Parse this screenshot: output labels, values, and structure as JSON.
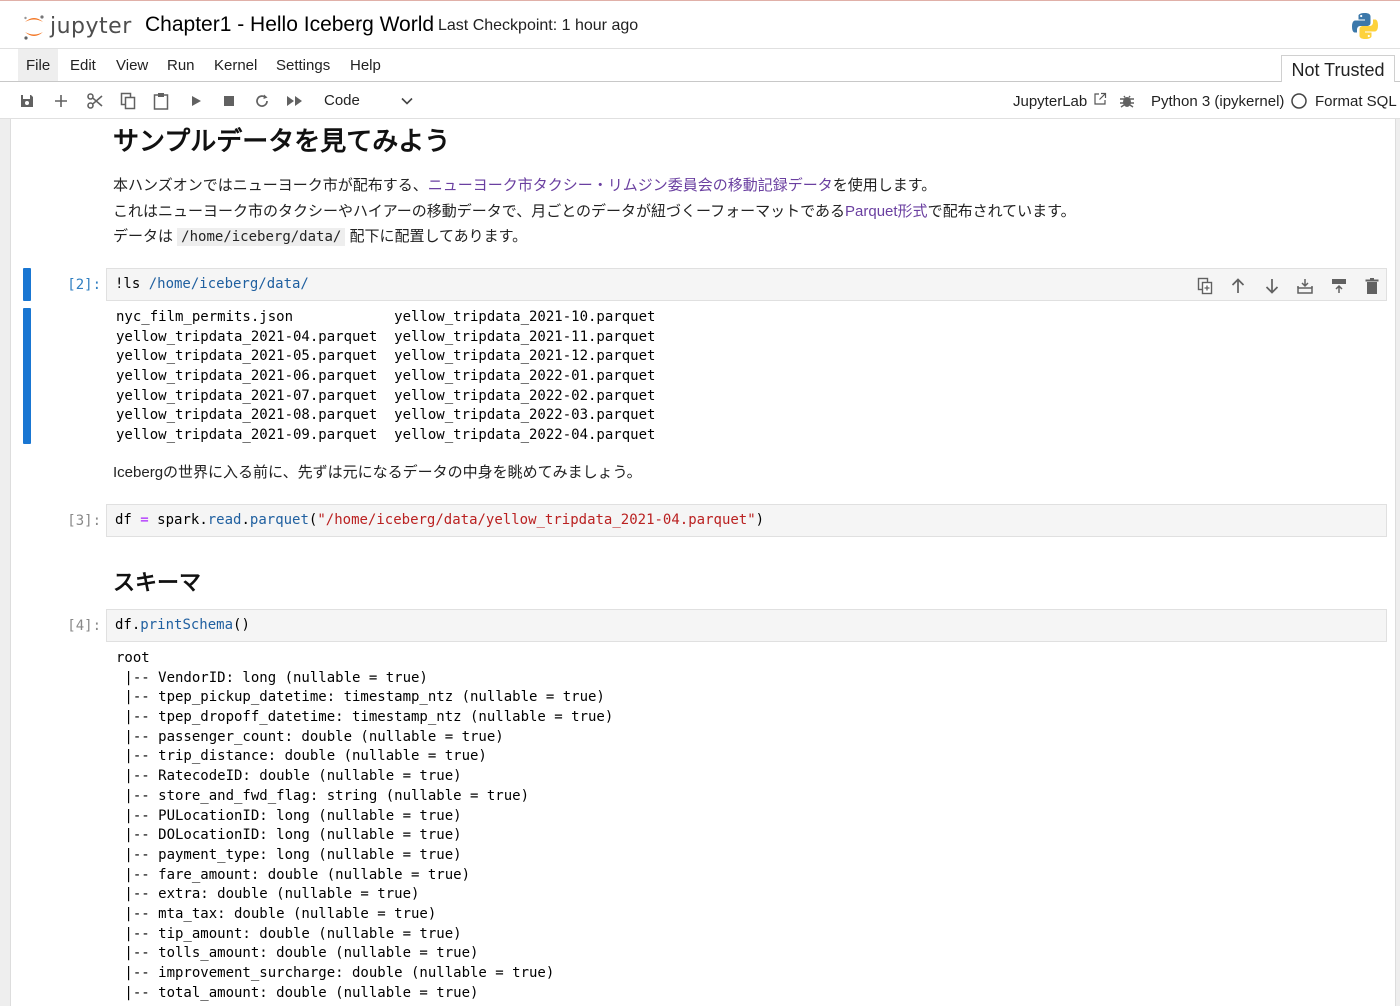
{
  "header": {
    "logo_text": "jupyter",
    "notebook_title": "Chapter1 - Hello Iceberg World",
    "checkpoint": "Last Checkpoint: 1 hour ago"
  },
  "menu": [
    "File",
    "Edit",
    "View",
    "Run",
    "Kernel",
    "Settings",
    "Help"
  ],
  "trust_status": "Not Trusted",
  "toolbar": {
    "cell_type": "Code",
    "jupyterlab_label": "JupyterLab",
    "kernel_name": "Python 3 (ipykernel)",
    "format_sql": "Format SQL"
  },
  "cells": {
    "md1": {
      "heading": "サンプルデータを見てみよう",
      "line1_pre": "本ハンズオンではニューヨーク市が配布する、",
      "line1_link": "ニューヨーク市タクシー・リムジン委員会の移動記録データ",
      "line1_post": "を使用します。",
      "line2_pre": "これはニューヨーク市のタクシーやハイアーの移動データで、月ごとのデータが紐づくーフォーマットである",
      "line2_link": "Parquet形式",
      "line2_post": "で配布されています。",
      "line3_pre": "データは ",
      "line3_code": "/home/iceberg/data/",
      "line3_post": " 配下に配置してあります。"
    },
    "code2": {
      "prompt": "[2]:",
      "source_cmd": "!ls ",
      "source_path": "/home/iceberg/data/",
      "output": [
        "nyc_film_permits.json            yellow_tripdata_2021-10.parquet",
        "yellow_tripdata_2021-04.parquet  yellow_tripdata_2021-11.parquet",
        "yellow_tripdata_2021-05.parquet  yellow_tripdata_2021-12.parquet",
        "yellow_tripdata_2021-06.parquet  yellow_tripdata_2022-01.parquet",
        "yellow_tripdata_2021-07.parquet  yellow_tripdata_2022-02.parquet",
        "yellow_tripdata_2021-08.parquet  yellow_tripdata_2022-03.parquet",
        "yellow_tripdata_2021-09.parquet  yellow_tripdata_2022-04.parquet"
      ]
    },
    "md2": {
      "text": "Icebergの世界に入る前に、先ずは元になるデータの中身を眺めてみましょう。"
    },
    "code3": {
      "prompt": "[3]:",
      "var": "df",
      "op": " = ",
      "obj": "spark",
      "attr1": "read",
      "attr2": "parquet",
      "arg": "\"/home/iceberg/data/yellow_tripdata_2021-04.parquet\""
    },
    "md3": {
      "heading": "スキーマ"
    },
    "code4": {
      "prompt": "[4]:",
      "obj": "df",
      "method": "printSchema",
      "output": [
        "root",
        " |-- VendorID: long (nullable = true)",
        " |-- tpep_pickup_datetime: timestamp_ntz (nullable = true)",
        " |-- tpep_dropoff_datetime: timestamp_ntz (nullable = true)",
        " |-- passenger_count: double (nullable = true)",
        " |-- trip_distance: double (nullable = true)",
        " |-- RatecodeID: double (nullable = true)",
        " |-- store_and_fwd_flag: string (nullable = true)",
        " |-- PULocationID: long (nullable = true)",
        " |-- DOLocationID: long (nullable = true)",
        " |-- payment_type: long (nullable = true)",
        " |-- fare_amount: double (nullable = true)",
        " |-- extra: double (nullable = true)",
        " |-- mta_tax: double (nullable = true)",
        " |-- tip_amount: double (nullable = true)",
        " |-- tolls_amount: double (nullable = true)",
        " |-- improvement_surcharge: double (nullable = true)",
        " |-- total_amount: double (nullable = true)"
      ]
    }
  }
}
